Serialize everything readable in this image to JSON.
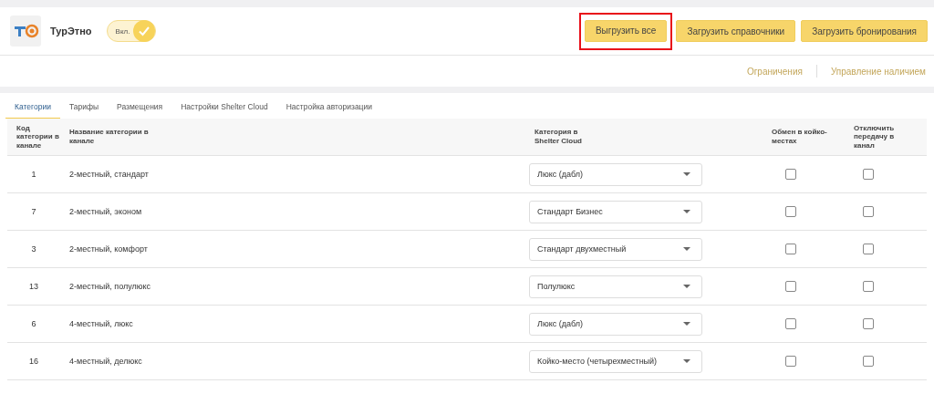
{
  "header": {
    "channel_name": "ТурЭтно",
    "toggle": {
      "label": "Вкл.",
      "on": true
    },
    "buttons": [
      {
        "label": "Выгрузить все",
        "highlighted": true
      },
      {
        "label": "Загрузить справочники",
        "highlighted": false
      },
      {
        "label": "Загрузить бронирования",
        "highlighted": false
      }
    ]
  },
  "links": [
    "Ограничения",
    "Управление наличием"
  ],
  "tabs": [
    {
      "label": "Категории",
      "selected": true
    },
    {
      "label": "Тарифы",
      "selected": false
    },
    {
      "label": "Размещения",
      "selected": false
    },
    {
      "label": "Настройки Shelter Cloud",
      "selected": false
    },
    {
      "label": "Настройка авторизации",
      "selected": false
    }
  ],
  "table": {
    "columns": [
      "Код категории в канале",
      "Название категории в канале",
      "Категория в Shelter Cloud",
      "Обмен в койко-местах",
      "Отключить передачу в канал"
    ],
    "rows": [
      {
        "code": "1",
        "name": "2-местный, стандарт",
        "category": "Люкс (дабл)",
        "beds_exchange": false,
        "disable_transfer": false
      },
      {
        "code": "7",
        "name": "2-местный, эконом",
        "category": "Стандарт Бизнес",
        "beds_exchange": false,
        "disable_transfer": false
      },
      {
        "code": "3",
        "name": "2-местный, комфорт",
        "category": "Стандарт двухместный",
        "beds_exchange": false,
        "disable_transfer": false
      },
      {
        "code": "13",
        "name": "2-местный, полулюкс",
        "category": "Полулюкс",
        "beds_exchange": false,
        "disable_transfer": false
      },
      {
        "code": "6",
        "name": "4-местный, люкс",
        "category": "Люкс (дабл)",
        "beds_exchange": false,
        "disable_transfer": false
      },
      {
        "code": "16",
        "name": "4-местный, делюкс",
        "category": "Койко-место (четырехместный)",
        "beds_exchange": false,
        "disable_transfer": false
      }
    ]
  }
}
